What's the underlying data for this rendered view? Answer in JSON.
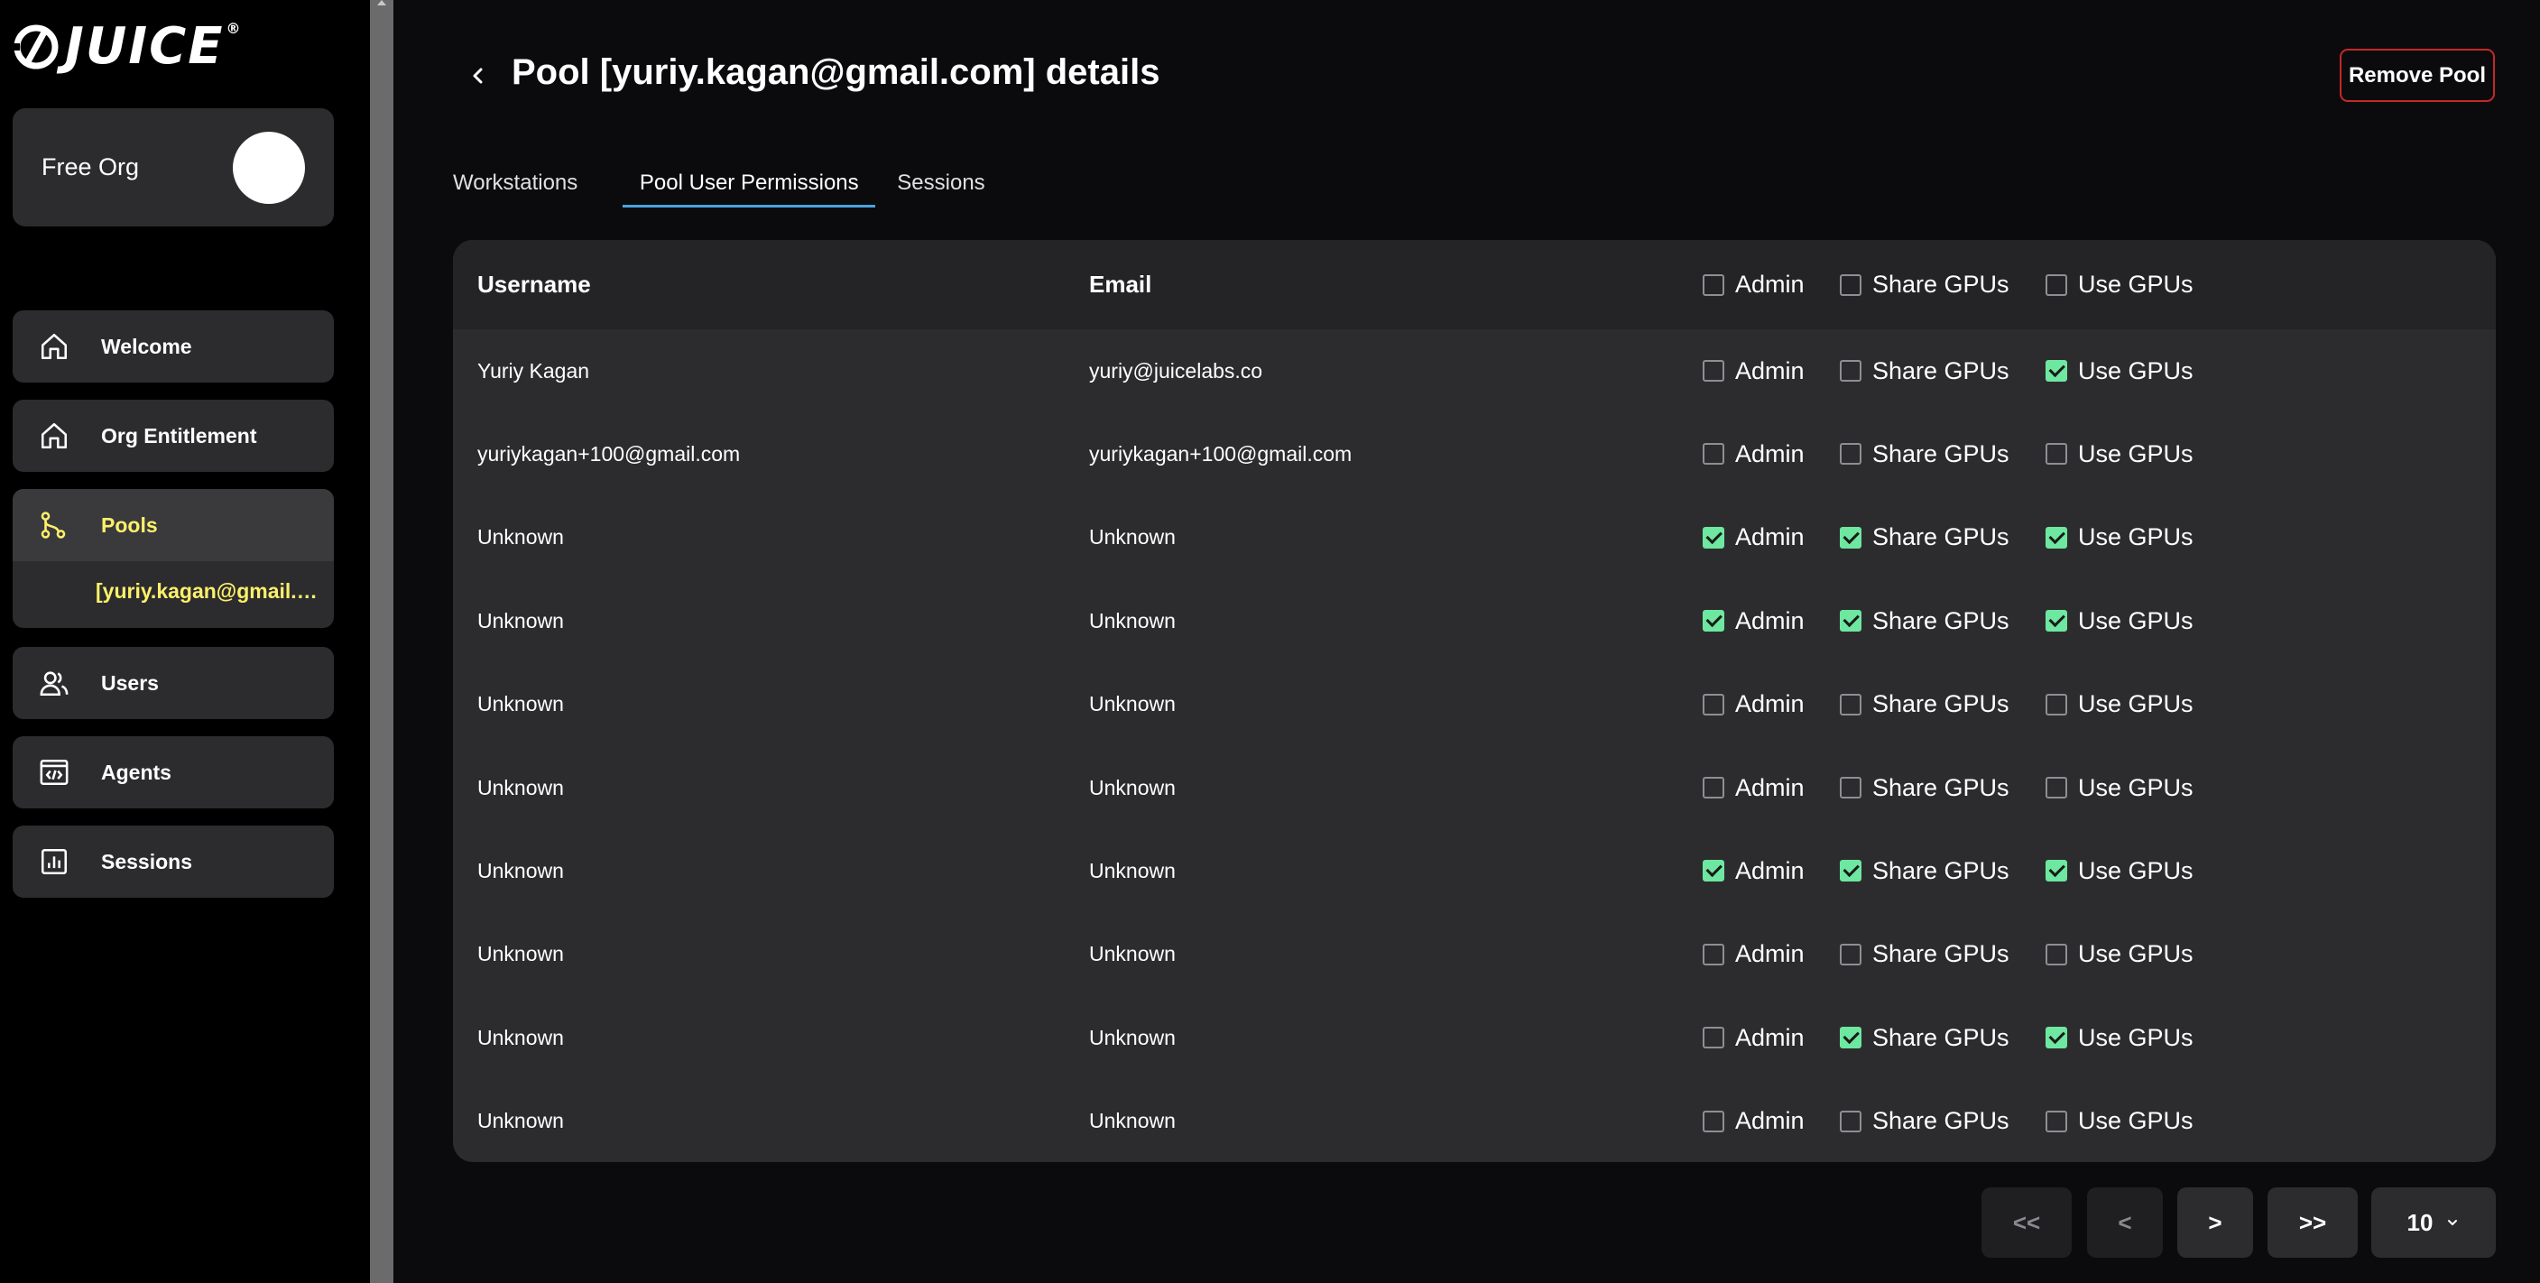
{
  "brand": {
    "name": "JUICE",
    "reg": "®"
  },
  "org": {
    "name": "Free Org"
  },
  "sidebar": {
    "items": [
      {
        "label": "Welcome",
        "icon": "home-icon"
      },
      {
        "label": "Org Entitlement",
        "icon": "home-icon"
      },
      {
        "label": "Pools",
        "icon": "git-branch-icon",
        "active": true
      },
      {
        "label": "Users",
        "icon": "users-icon"
      },
      {
        "label": "Agents",
        "icon": "agent-code-icon"
      },
      {
        "label": "Sessions",
        "icon": "chart-icon"
      }
    ],
    "pool_sub_item": "[yuriy.kagan@gmail.com]"
  },
  "header": {
    "title": "Pool [yuriy.kagan@gmail.com] details",
    "remove_label": "Remove Pool"
  },
  "tabs": [
    {
      "label": "Workstations"
    },
    {
      "label": "Pool User Permissions",
      "active": true
    },
    {
      "label": "Sessions"
    }
  ],
  "table": {
    "columns": {
      "username": "Username",
      "email": "Email",
      "admin": "Admin",
      "share": "Share GPUs",
      "use": "Use GPUs"
    },
    "rows": [
      {
        "username": "Yuriy Kagan",
        "email": "yuriy@juicelabs.co",
        "admin": false,
        "share": false,
        "use": true
      },
      {
        "username": "yuriykagan+100@gmail.com",
        "email": "yuriykagan+100@gmail.com",
        "admin": false,
        "share": false,
        "use": false
      },
      {
        "username": "Unknown",
        "email": "Unknown",
        "admin": true,
        "share": true,
        "use": true
      },
      {
        "username": "Unknown",
        "email": "Unknown",
        "admin": true,
        "share": true,
        "use": true
      },
      {
        "username": "Unknown",
        "email": "Unknown",
        "admin": false,
        "share": false,
        "use": false
      },
      {
        "username": "Unknown",
        "email": "Unknown",
        "admin": false,
        "share": false,
        "use": false
      },
      {
        "username": "Unknown",
        "email": "Unknown",
        "admin": true,
        "share": true,
        "use": true
      },
      {
        "username": "Unknown",
        "email": "Unknown",
        "admin": false,
        "share": false,
        "use": false
      },
      {
        "username": "Unknown",
        "email": "Unknown",
        "admin": false,
        "share": true,
        "use": true
      },
      {
        "username": "Unknown",
        "email": "Unknown",
        "admin": false,
        "share": false,
        "use": false
      }
    ]
  },
  "pagination": {
    "first": "<<",
    "prev": "<",
    "next": ">",
    "last": ">>",
    "page_size": "10"
  },
  "colors": {
    "accent_yellow": "#fdf06a",
    "check_green": "#6ee7a0",
    "tab_underline": "#4aa3df",
    "danger": "#c62828"
  }
}
